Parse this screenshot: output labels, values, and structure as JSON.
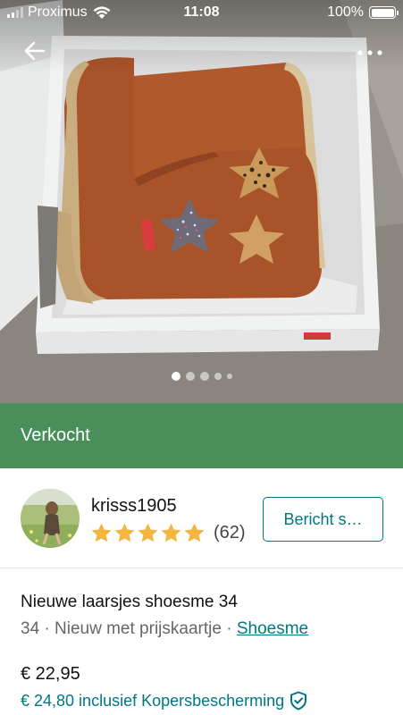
{
  "status_bar": {
    "carrier": "Proximus",
    "time": "11:08",
    "battery": "100%",
    "battery_level": 1.0
  },
  "gallery": {
    "photo_count": 5,
    "active_index": 0,
    "photo_description_icon": "boots-in-box-photo"
  },
  "top_actions": {
    "back_icon": "arrow-left-icon",
    "more_icon": "more-horizontal-icon"
  },
  "sold_banner": {
    "label": "Verkocht",
    "color": "#4a8f59"
  },
  "seller": {
    "username": "krisss1905",
    "rating": 5,
    "review_count": "(62)",
    "message_button": "Bericht s…"
  },
  "item": {
    "title": "Nieuwe laarsjes shoesme 34",
    "size": "34",
    "separator": "·",
    "condition": "Nieuw met prijskaartje",
    "brand": "Shoesme"
  },
  "pricing": {
    "price": "€ 22,95",
    "price_with_protection": "€ 24,80 inclusief Kopersbescherming"
  },
  "colors": {
    "accent": "#007782",
    "sold_green": "#4a8f59",
    "star": "#f4b63f"
  }
}
